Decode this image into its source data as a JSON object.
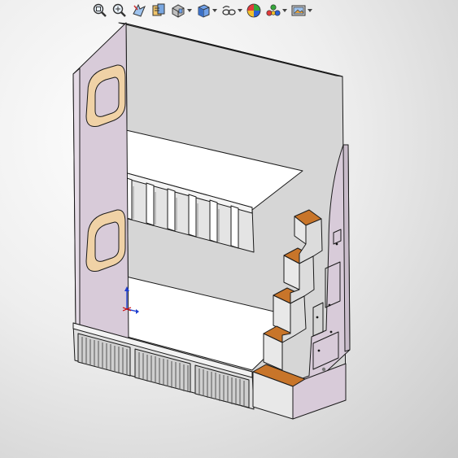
{
  "app": {
    "toolbar": {
      "buttons": [
        {
          "name": "zoom-to-fit",
          "icon": "zoom-fit-icon",
          "dropdown": false
        },
        {
          "name": "zoom-to-area",
          "icon": "zoom-area-icon",
          "dropdown": false
        },
        {
          "name": "previous-view",
          "icon": "previous-view-icon",
          "dropdown": false
        },
        {
          "name": "section-view",
          "icon": "section-view-icon",
          "dropdown": false
        },
        {
          "name": "view-orientation",
          "icon": "view-orientation-icon",
          "dropdown": true
        },
        {
          "name": "display-style",
          "icon": "display-style-icon",
          "dropdown": true
        },
        {
          "name": "hide-show-items",
          "icon": "hide-show-icon",
          "dropdown": true
        },
        {
          "name": "edit-appearance",
          "icon": "appearance-icon",
          "dropdown": false
        },
        {
          "name": "apply-scene",
          "icon": "scene-icon",
          "dropdown": true
        },
        {
          "name": "view-settings",
          "icon": "view-settings-icon",
          "dropdown": true
        }
      ]
    },
    "colors": {
      "panel_lavender": "#d8cbd9",
      "back_panel": "#d6d6d6",
      "mattress": "#ffffff",
      "step_wood": "#c8752a",
      "outline": "#1a1a1a",
      "triad_blue": "#1f3fd0"
    }
  }
}
